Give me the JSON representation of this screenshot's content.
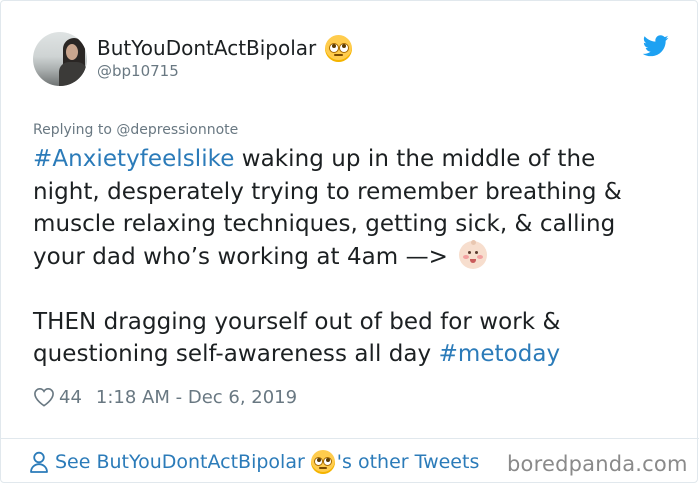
{
  "author": {
    "display_name": "ButYouDontActBipolar",
    "handle": "@bp10715",
    "name_emoji_icon": "face-with-rolling-eyes-icon"
  },
  "reply": {
    "text": "Replying to @depressionnote"
  },
  "tweet": {
    "line1_tag": "#Anxietyfeelslike",
    "line1_rest": " waking up in the middle of the",
    "line2": "night, desperately trying to remember breathing &",
    "line3": "muscle relaxing techniques, getting sick, & calling",
    "line4": "your dad who’s working at 4am —> ",
    "line4_emoji_icon": "baby-face-icon",
    "line5": "THEN dragging yourself out of bed for work &",
    "line6_text": "questioning self-awareness all day ",
    "line6_tag": "#metoday"
  },
  "meta": {
    "likes": "44",
    "timestamp": "1:18 AM - Dec 6, 2019"
  },
  "footer": {
    "link_prefix": "See ButYouDontActBipolar",
    "link_suffix": "'s other Tweets"
  },
  "watermark": "boredpanda.com",
  "colors": {
    "link": "#2b7bb9",
    "meta": "#697882",
    "text": "#1c2022",
    "twitter_bird": "#1da1f2",
    "border": "#e1e8ed"
  }
}
